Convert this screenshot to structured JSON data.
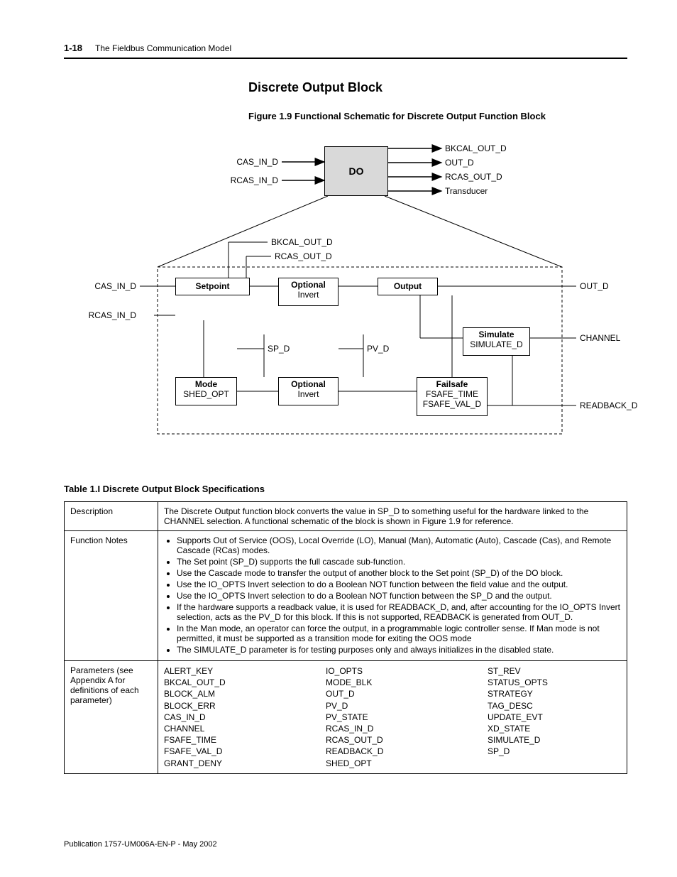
{
  "header": {
    "page_num": "1-18",
    "chapter": "The Fieldbus Communication Model"
  },
  "section_title": "Discrete Output Block",
  "figure_caption": "Figure 1.9  Functional Schematic for Discrete Output Function Block",
  "diagram": {
    "do_box": "DO",
    "top_left_in": [
      "CAS_IN_D",
      "RCAS_IN_D"
    ],
    "top_right_out": [
      "BKCAL_OUT_D",
      "OUT_D",
      "RCAS_OUT_D",
      "Transducer"
    ],
    "left_in": [
      "CAS_IN_D",
      "RCAS_IN_D"
    ],
    "right_out_top": "OUT_D",
    "right_mid": "CHANNEL",
    "right_bot": "READBACK_D",
    "center_labels": {
      "bkcal": "BKCAL_OUT_D",
      "rcas": "RCAS_OUT_D",
      "sp": "SP_D",
      "pv": "PV_D"
    },
    "boxes": {
      "setpoint": {
        "title": "Setpoint"
      },
      "optional1": {
        "title": "Optional",
        "sub": "Invert"
      },
      "output": {
        "title": "Output"
      },
      "simulate": {
        "title": "Simulate",
        "sub": "SIMULATE_D"
      },
      "mode": {
        "title": "Mode",
        "sub": "SHED_OPT"
      },
      "optional2": {
        "title": "Optional",
        "sub": "Invert"
      },
      "failsafe": {
        "title": "Failsafe",
        "sub1": "FSAFE_TIME",
        "sub2": "FSAFE_VAL_D"
      }
    }
  },
  "table_caption": "Table 1.I  Discrete Output Block Specifications",
  "table": {
    "row1": {
      "label": "Description",
      "text": "The Discrete Output function block converts the value in SP_D to something useful for the hardware linked to the CHANNEL selection. A functional schematic of the block is shown in Figure 1.9 for reference."
    },
    "row2": {
      "label": "Function Notes",
      "items": [
        "Supports Out of Service (OOS), Local Override (LO), Manual (Man), Automatic (Auto), Cascade (Cas), and Remote Cascade (RCas) modes.",
        "The Set point (SP_D) supports the full cascade sub-function.",
        "Use the Cascade mode to transfer the output of another block to the Set point (SP_D) of the DO block.",
        "Use the IO_OPTS Invert selection to do a Boolean NOT function between the field value and the output.",
        "Use the IO_OPTS Invert selection to do a Boolean NOT function between the SP_D and the output.",
        "If the hardware supports a readback value, it is used for READBACK_D, and, after accounting for the IO_OPTS Invert selection, acts as the PV_D for this block. If this is not supported, READBACK is generated from OUT_D.",
        "In the Man mode, an operator can force the output, in a programmable logic controller sense. If Man mode is not permitted, it must be supported as a transition mode for exiting the OOS mode",
        "The SIMULATE_D parameter is for testing purposes only and always initializes in the disabled state."
      ]
    },
    "row3": {
      "label": "Parameters (see Appendix A for definitions of each parameter)",
      "col1": [
        "ALERT_KEY",
        "BKCAL_OUT_D",
        "BLOCK_ALM",
        "BLOCK_ERR",
        "CAS_IN_D",
        "CHANNEL",
        "FSAFE_TIME",
        "FSAFE_VAL_D",
        "GRANT_DENY"
      ],
      "col2": [
        "IO_OPTS",
        "MODE_BLK",
        "OUT_D",
        "PV_D",
        "PV_STATE",
        "RCAS_IN_D",
        "RCAS_OUT_D",
        "READBACK_D",
        "SHED_OPT"
      ],
      "col3": [
        "ST_REV",
        "STATUS_OPTS",
        "STRATEGY",
        "TAG_DESC",
        "UPDATE_EVT",
        "XD_STATE",
        "SIMULATE_D",
        "SP_D"
      ]
    }
  },
  "footer": "Publication 1757-UM006A-EN-P - May 2002"
}
